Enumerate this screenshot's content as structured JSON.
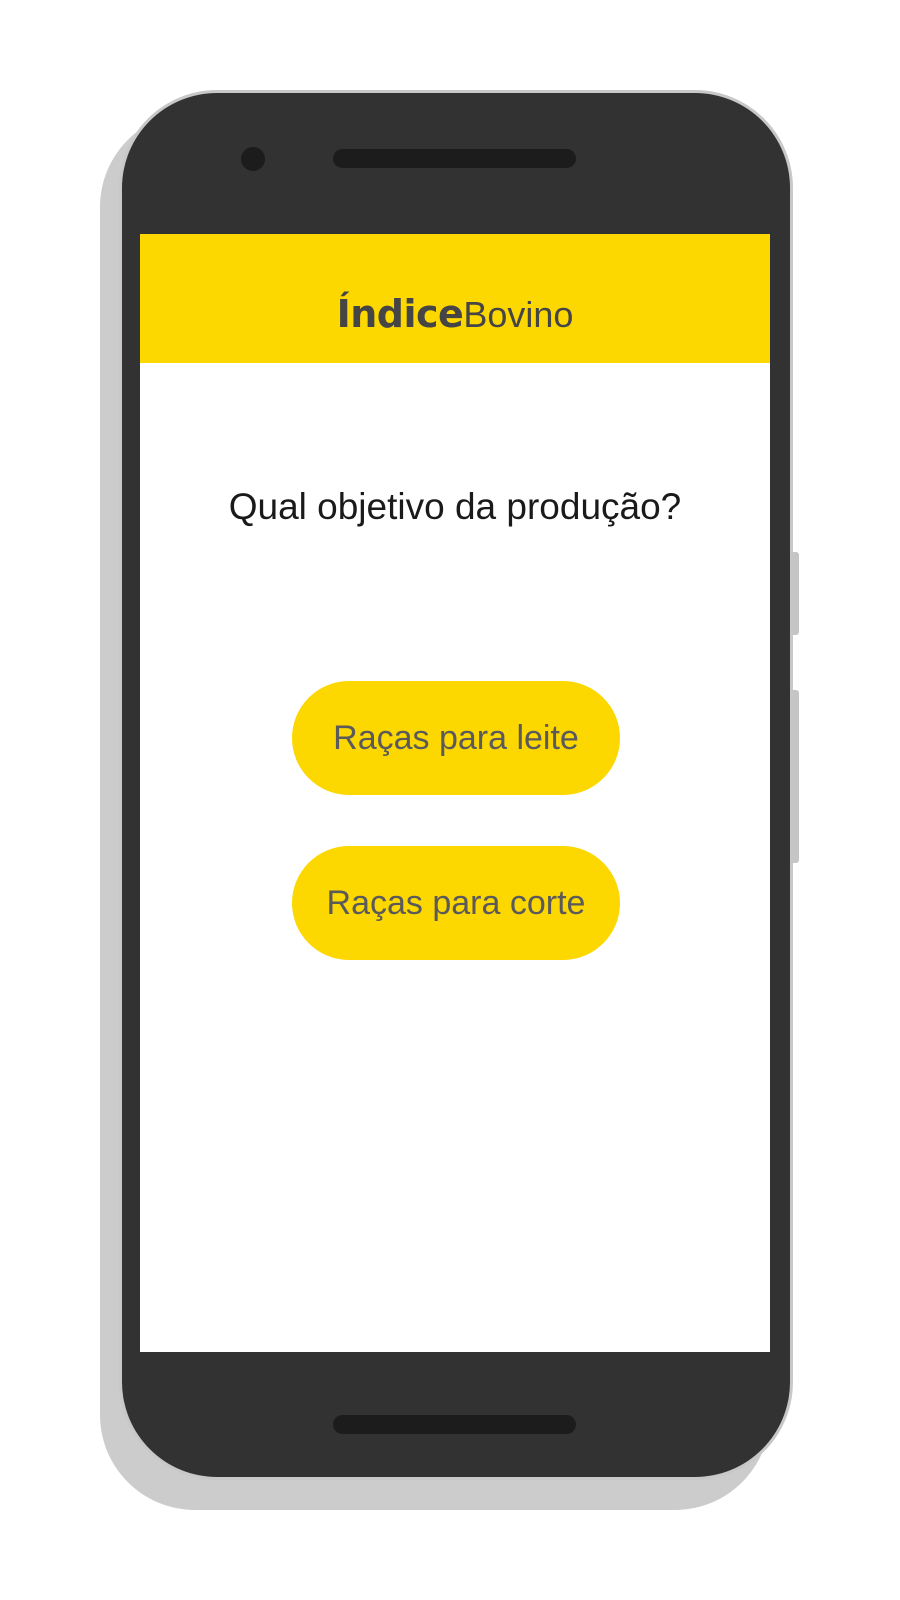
{
  "app": {
    "logo_bold": "Índice",
    "logo_regular": "Bovino"
  },
  "main": {
    "question": "Qual objetivo da produção?",
    "options": [
      {
        "label": "Raças para leite"
      },
      {
        "label": "Raças para corte"
      }
    ]
  },
  "colors": {
    "brand_yellow": "#fdd700",
    "phone_body": "#323232",
    "logo_text": "#454545",
    "button_text": "#5a5a5a"
  }
}
